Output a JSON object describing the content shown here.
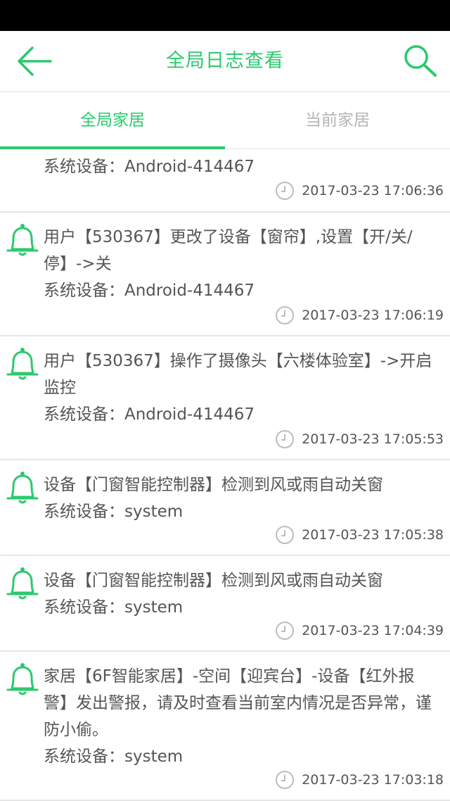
{
  "header": {
    "title": "全局日志查看",
    "back_icon": "back-arrow-icon",
    "search_icon": "search-icon",
    "accent_color": "#2bc96d"
  },
  "tabs": [
    {
      "label": "全局家居",
      "active": true
    },
    {
      "label": "当前家居",
      "active": false
    }
  ],
  "logs": [
    {
      "message": "",
      "device": "系统设备：Android-414467",
      "time": "2017-03-23 17:06:36"
    },
    {
      "message": "用户【530367】更改了设备【窗帘】,设置【开/关/停】->关",
      "device": "系统设备：Android-414467",
      "time": "2017-03-23 17:06:19"
    },
    {
      "message": "用户【530367】操作了摄像头【六楼体验室】->开启监控",
      "device": "系统设备：Android-414467",
      "time": "2017-03-23 17:05:53"
    },
    {
      "message": "设备【门窗智能控制器】检测到风或雨自动关窗",
      "device": "系统设备：system",
      "time": "2017-03-23 17:05:38"
    },
    {
      "message": "设备【门窗智能控制器】检测到风或雨自动关窗",
      "device": "系统设备：system",
      "time": "2017-03-23 17:04:39"
    },
    {
      "message": "家居【6F智能家居】-空间【迎宾台】-设备【红外报警】发出警报，请及时查看当前室内情况是否异常，谨防小偷。",
      "device": "系统设备：system",
      "time": "2017-03-23 17:03:18"
    }
  ]
}
